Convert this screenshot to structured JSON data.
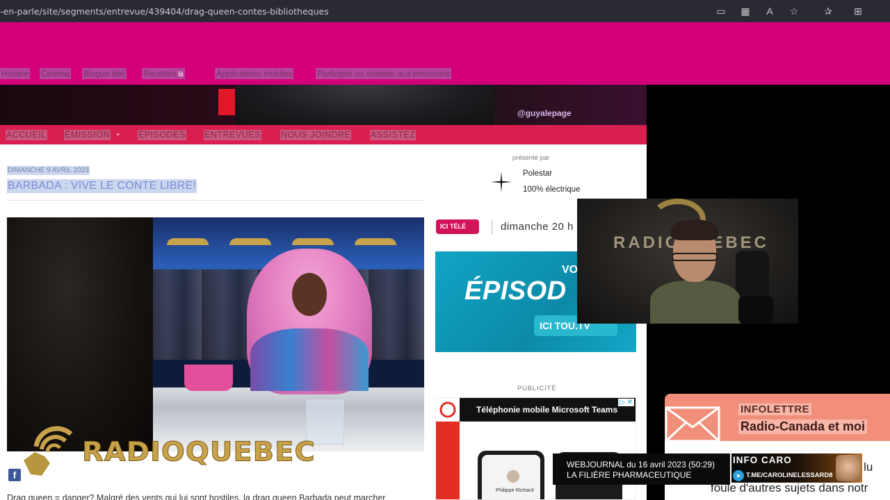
{
  "browser": {
    "url": "-en-parle/site/segments/entrevue/439404/drag-queen-contes-bibliotheques",
    "icons": [
      "reader-view-icon",
      "apps-icon",
      "read-aloud-icon",
      "favorite-add-icon",
      "favorites-icon",
      "collections-icon"
    ]
  },
  "site": {
    "brand_color": "#d4007a",
    "topnav": [
      {
        "label": "Horaire"
      },
      {
        "label": "Cinéma"
      },
      {
        "label": "Blogue télé"
      },
      {
        "label": "Recettes"
      },
      {
        "label": "Applications mobiles"
      },
      {
        "label": "Participer ou assister aux émissions"
      }
    ]
  },
  "banner": {
    "handle": "@guyalepage"
  },
  "shownav": {
    "color": "#d81f4f",
    "items": [
      {
        "label": "ACCUEIL"
      },
      {
        "label": "ÉMISSION"
      },
      {
        "label": "ÉPISODES"
      },
      {
        "label": "ENTREVUES"
      },
      {
        "label": "NOUS JOINDRE"
      },
      {
        "label": "ASSISTEZ"
      }
    ]
  },
  "article": {
    "date": "DIMANCHE 9 AVRIL 2023",
    "title": "BARBADA : VIVE LE CONTE LIBRE!",
    "description": "Drag queen = danger? Malgré des vents qui lui sont hostiles, la drag queen Barbada peut marcher"
  },
  "watermark": {
    "text": "RADIOQUEBEC"
  },
  "sidebar": {
    "presented_by": "présenté par",
    "sponsor_name": "Polestar",
    "sponsor_tagline": "100% électrique",
    "ici_tele_badge": "ICI  TÉLÉ",
    "airtime": "dimanche 20 h",
    "promo_vo": "VO",
    "promo_big": "ÉPISOD",
    "promo_ici_tv": "ICI  TOU.TV",
    "pub_label": "PUBLICITÉ",
    "ad_title": "Téléphonie mobile Microsoft Teams",
    "ad_choice": "▷ ✕",
    "ad_contact": "Philippe Richard"
  },
  "webcam": {
    "logo_text": "RADIO Q EBEC"
  },
  "newsletter": {
    "label1": "INFOLETTRE",
    "label2": "Radio-Canada et moi",
    "text1": "e et lu",
    "text2": "foule d'autres sujets dans notr"
  },
  "lower_third": {
    "line1": "WEBJOURNAL du 16 avril 2023 (50:29)",
    "line2": "LA FILIÈRE PHARMACEUTIQUE"
  },
  "info_caro": {
    "title": "INFO CARO",
    "link": "T.ME/CAROLINELESSARD8"
  }
}
